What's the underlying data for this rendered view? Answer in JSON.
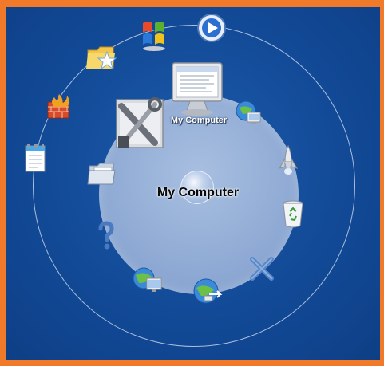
{
  "center": {
    "label": "My Computer",
    "top_label": "My Computer"
  },
  "icons": {
    "windows_media": "windows-media-player-icon",
    "windows_logo": "windows-logo-icon",
    "explorer_star": "folder-star-icon",
    "firewall": "firewall-icon",
    "notepad": "notepad-icon",
    "monitor": "monitor-icon",
    "tools": "tools-icon",
    "network_globe": "network-globe-icon",
    "rocket": "shuttle-icon",
    "recycle_bin": "recycle-bin-icon",
    "close_x": "close-x-icon",
    "globe_bottom": "globe-arrow-icon",
    "globe_bottom_left": "globe-computer-icon",
    "help": "help-question-icon",
    "folder_inner": "folder-icon"
  },
  "colors": {
    "border": "#f07a2a",
    "desktop": "#124a97",
    "disc": "#8faad4"
  }
}
